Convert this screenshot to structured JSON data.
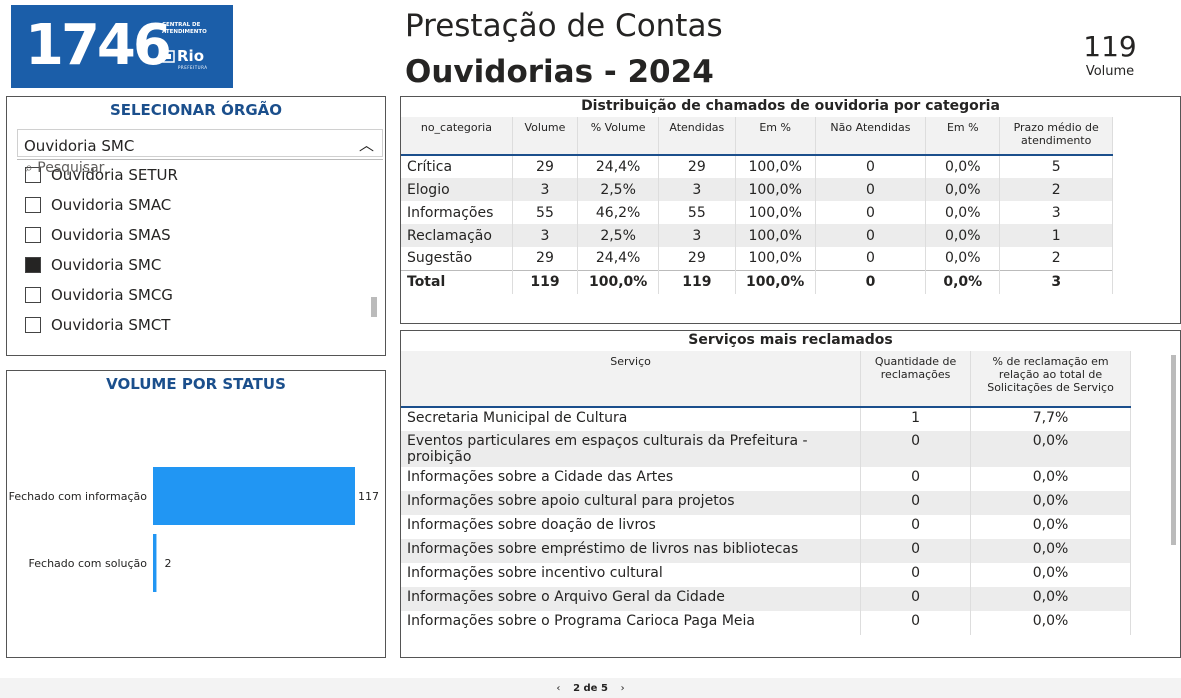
{
  "logo": {
    "number": "1746",
    "line1": "CENTRAL DE",
    "line2": "ATENDIMENTO",
    "brand": "Rio",
    "brand_sub": "PREFEITURA"
  },
  "header": {
    "title_line1": "Prestação de Contas",
    "title_line2": "Ouvidorias - 2024"
  },
  "volume_card": {
    "value": "119",
    "label": "Volume"
  },
  "slicer": {
    "title": "SELECIONAR ÓRGÃO",
    "selected": "Ouvidoria SMC",
    "search_placeholder": "Pesquisar",
    "items": [
      {
        "label": "Ouvidoria SETUR",
        "checked": false
      },
      {
        "label": "Ouvidoria SMAC",
        "checked": false
      },
      {
        "label": "Ouvidoria SMAS",
        "checked": false
      },
      {
        "label": "Ouvidoria SMC",
        "checked": true
      },
      {
        "label": "Ouvidoria SMCG",
        "checked": false
      },
      {
        "label": "Ouvidoria SMCT",
        "checked": false
      }
    ]
  },
  "status_chart": {
    "title": "VOLUME POR STATUS",
    "chart_data": {
      "type": "bar",
      "orientation": "horizontal",
      "categories": [
        "Fechado com informação",
        "Fechado com solução"
      ],
      "values": [
        117,
        2
      ],
      "data_labels": [
        "117",
        "2"
      ],
      "color": "#2196f3"
    }
  },
  "category_table": {
    "title": "Distribuição de chamados de ouvidoria por categoria",
    "columns": [
      "no_categoria",
      "Volume",
      "% Volume",
      "Atendidas",
      "Em %",
      "Não Atendidas",
      "Em %",
      "Prazo médio de atendimento"
    ],
    "rows": [
      [
        "Crítica",
        "29",
        "24,4%",
        "29",
        "100,0%",
        "0",
        "0,0%",
        "5"
      ],
      [
        "Elogio",
        "3",
        "2,5%",
        "3",
        "100,0%",
        "0",
        "0,0%",
        "2"
      ],
      [
        "Informações",
        "55",
        "46,2%",
        "55",
        "100,0%",
        "0",
        "0,0%",
        "3"
      ],
      [
        "Reclamação",
        "3",
        "2,5%",
        "3",
        "100,0%",
        "0",
        "0,0%",
        "1"
      ],
      [
        "Sugestão",
        "29",
        "24,4%",
        "29",
        "100,0%",
        "0",
        "0,0%",
        "2"
      ]
    ],
    "total": [
      "Total",
      "119",
      "100,0%",
      "119",
      "100,0%",
      "0",
      "0,0%",
      "3"
    ]
  },
  "services_table": {
    "title": "Serviços mais reclamados",
    "columns": [
      "Serviço",
      "Quantidade de reclamações",
      "% de reclamação em relação ao total de Solicitações de Serviço"
    ],
    "rows": [
      [
        "Secretaria Municipal de Cultura",
        "1",
        "7,7%"
      ],
      [
        "Eventos particulares em espaços culturais da Prefeitura - proibição",
        "0",
        "0,0%"
      ],
      [
        "Informações sobre a Cidade das Artes",
        "0",
        "0,0%"
      ],
      [
        "Informações sobre apoio cultural para projetos",
        "0",
        "0,0%"
      ],
      [
        "Informações sobre doação de livros",
        "0",
        "0,0%"
      ],
      [
        "Informações sobre empréstimo de livros nas bibliotecas",
        "0",
        "0,0%"
      ],
      [
        "Informações sobre incentivo cultural",
        "0",
        "0,0%"
      ],
      [
        "Informações sobre o Arquivo Geral da Cidade",
        "0",
        "0,0%"
      ],
      [
        "Informações sobre o Programa Carioca Paga Meia",
        "0",
        "0,0%"
      ]
    ]
  },
  "footer": {
    "prev": "‹",
    "page": "2 de 5",
    "next": "›"
  }
}
